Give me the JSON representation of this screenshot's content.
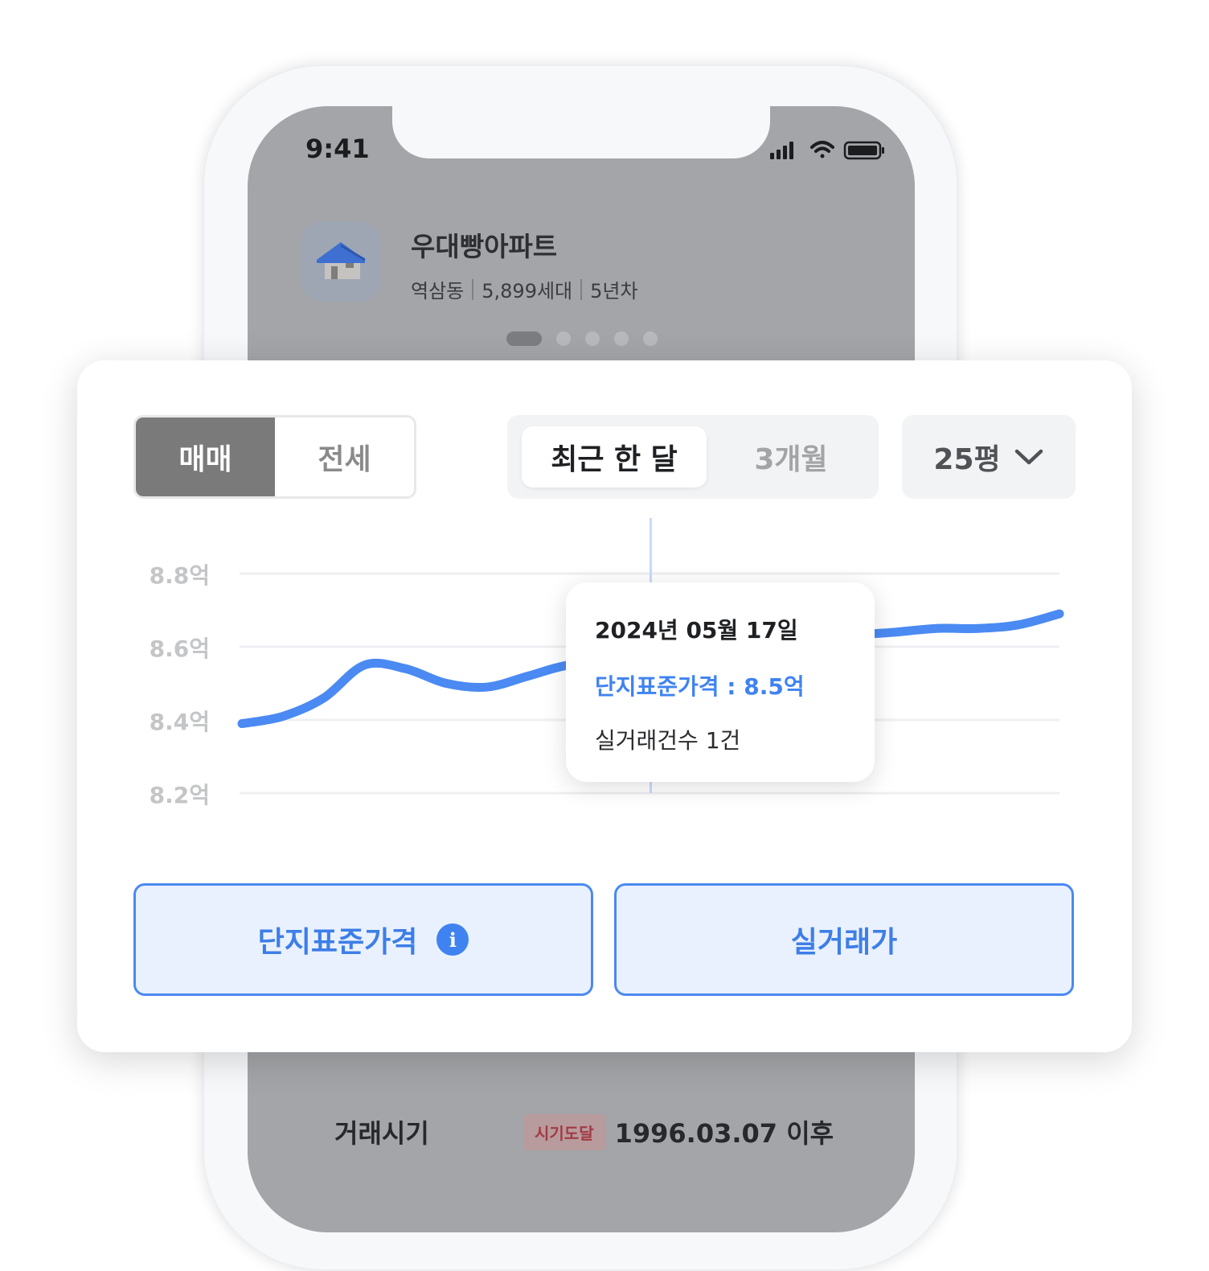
{
  "status_bar": {
    "time": "9:41"
  },
  "apartment": {
    "name": "우대빵아파트",
    "meta": [
      "역삼동",
      "5,899세대",
      "5년차"
    ]
  },
  "tabs": {
    "trade_type": {
      "options": [
        "매매",
        "전세"
      ],
      "selected": "매매"
    },
    "period": {
      "options": [
        "최근 한 달",
        "3개월"
      ],
      "selected": "최근 한 달"
    },
    "size": "25평"
  },
  "colors": {
    "accent": "#3f83f0",
    "line": "#4a8af2",
    "badge_text": "#a33a44"
  },
  "tooltip": {
    "date": "2024년 05월 17일",
    "price": "단지표준가격 : 8.5억",
    "count": "실거래건수 1건"
  },
  "buttons": {
    "standard_price": "단지표준가격",
    "real_price": "실거래가",
    "info_icon": "i"
  },
  "deal": {
    "label": "거래시기",
    "badge": "시기도달",
    "date": "1996.03.07 이후"
  },
  "chart_data": {
    "type": "line",
    "y_tick_labels": [
      "8.8억",
      "8.6억",
      "8.4억",
      "8.2억"
    ],
    "ylim": [
      8.2,
      8.8
    ],
    "grid": true,
    "series": [
      {
        "values": [
          8.39,
          8.41,
          8.46,
          8.55,
          8.54,
          8.5,
          8.49,
          8.52,
          8.55,
          8.55,
          8.54,
          8.55,
          8.55,
          8.57,
          8.6,
          8.63,
          8.64,
          8.65,
          8.65,
          8.66,
          8.69
        ]
      }
    ],
    "highlight_index": 10
  }
}
